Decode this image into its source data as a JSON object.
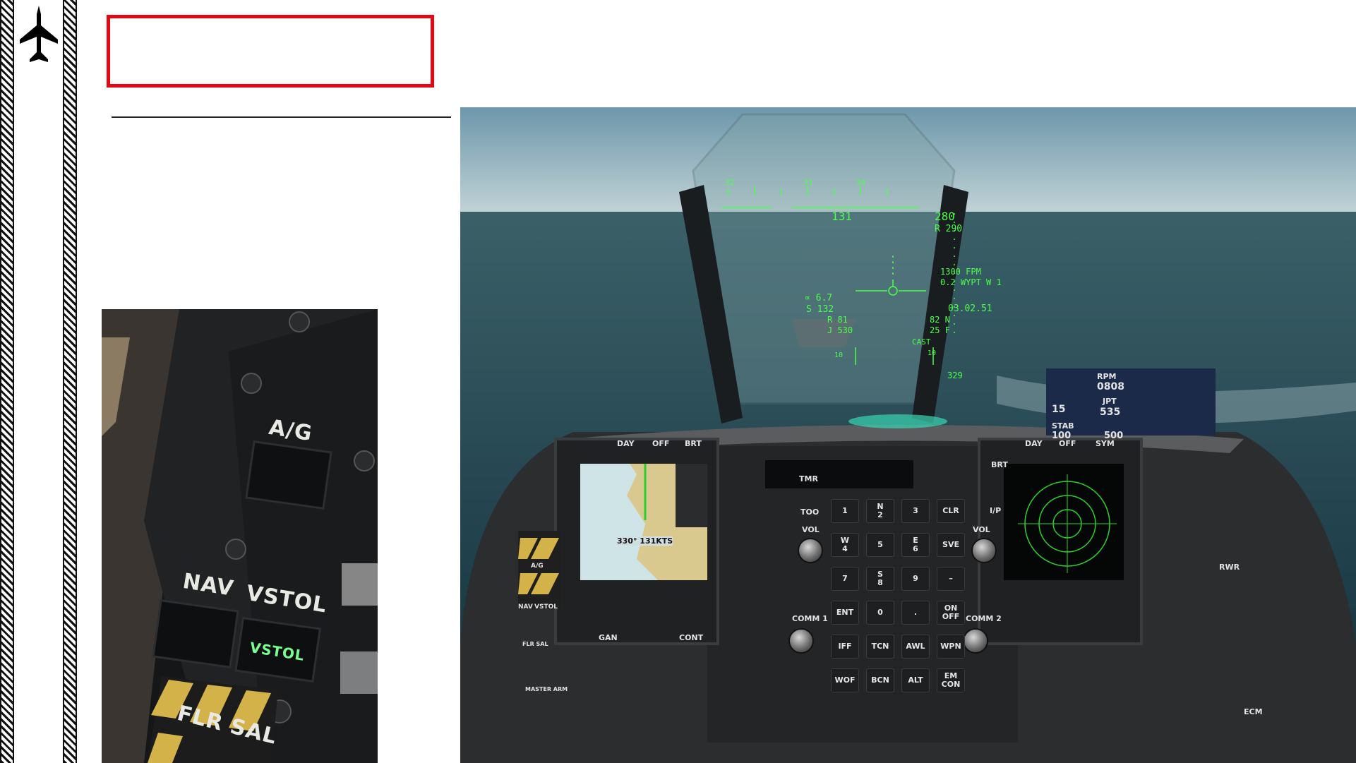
{
  "page": {
    "title": ""
  },
  "inset": {
    "labels": {
      "ag": "A/G",
      "nav": "NAV",
      "vstol": "VSTOL",
      "vstol_light": "VSTOL",
      "flr_sal": "FLR  SAL"
    }
  },
  "hud": {
    "heading_ticks": [
      "32",
      "33",
      "34"
    ],
    "airspeed": "131",
    "altitude": "280",
    "radar_alt": "R 290",
    "vvi": "1300 FPM",
    "waypoint": "0.2 WYPT W 1",
    "alpha": "∝ 6.7",
    "speed_s": "S 132",
    "r_val": "R    81",
    "j_val": "J  530",
    "nozzle": "82 N",
    "flaps": "25 F",
    "time": "03.02.51",
    "cast": "CAST",
    "ladder_low": "10",
    "ladder_high": "10",
    "bottom": "329"
  },
  "ufc": {
    "tmr": "TMR",
    "too": "TOO",
    "vol_left": "VOL",
    "vol_right": "VOL",
    "comm1": "COMM 1",
    "comm2": "COMM 2",
    "ip": "I/P",
    "brt": "BRT",
    "keys": [
      {
        "label": "1"
      },
      {
        "label": "N\n2"
      },
      {
        "label": "3"
      },
      {
        "label": "CLR"
      },
      {
        "label": "W\n4"
      },
      {
        "label": "5"
      },
      {
        "label": "E\n6"
      },
      {
        "label": "SVE"
      },
      {
        "label": "7"
      },
      {
        "label": "S\n8"
      },
      {
        "label": "9"
      },
      {
        "label": "–"
      },
      {
        "label": "ENT"
      },
      {
        "label": "0"
      },
      {
        "label": "."
      },
      {
        "label": "ON\nOFF"
      },
      {
        "label": "IFF"
      },
      {
        "label": "TCN"
      },
      {
        "label": "AWL"
      },
      {
        "label": "WPN"
      },
      {
        "label": "WOF"
      },
      {
        "label": "BCN"
      },
      {
        "label": "ALT"
      },
      {
        "label": "EM\nCON"
      }
    ]
  },
  "mpcd_left": {
    "heading_readout": "330° 131KTS",
    "day": "DAY",
    "off": "OFF",
    "brt": "BRT",
    "gan": "GAN",
    "cont": "CONT"
  },
  "mpcd_right": {
    "day": "DAY",
    "off": "OFF",
    "sym": "SYM",
    "rwr": "RWR",
    "ecm": "ECM"
  },
  "engine": {
    "rpm_label": "RPM",
    "rpm": "0808",
    "jpt_label": "JPT",
    "jpt": "535",
    "ff": "15",
    "stab_label": "STAB",
    "stab": "100",
    "h2o": "500"
  },
  "master_mode": {
    "ag": "A/G",
    "nav": "NAV",
    "vstol": "VSTOL",
    "flr_sal": "FLR SAL",
    "master_arm": "MASTER ARM"
  },
  "colors": {
    "accent_red": "#e30613",
    "hud_green": "#4cff4c",
    "sky": "#8fb3c0",
    "sea": "#1f4452"
  }
}
